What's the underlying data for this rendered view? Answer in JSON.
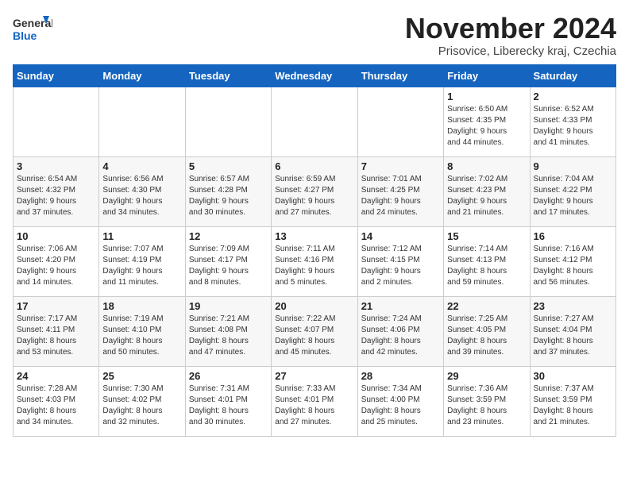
{
  "logo": {
    "text_general": "General",
    "text_blue": "Blue"
  },
  "title": "November 2024",
  "subtitle": "Prisovice, Liberecky kraj, Czechia",
  "days_of_week": [
    "Sunday",
    "Monday",
    "Tuesday",
    "Wednesday",
    "Thursday",
    "Friday",
    "Saturday"
  ],
  "weeks": [
    [
      {
        "day": "",
        "info": ""
      },
      {
        "day": "",
        "info": ""
      },
      {
        "day": "",
        "info": ""
      },
      {
        "day": "",
        "info": ""
      },
      {
        "day": "",
        "info": ""
      },
      {
        "day": "1",
        "info": "Sunrise: 6:50 AM\nSunset: 4:35 PM\nDaylight: 9 hours\nand 44 minutes."
      },
      {
        "day": "2",
        "info": "Sunrise: 6:52 AM\nSunset: 4:33 PM\nDaylight: 9 hours\nand 41 minutes."
      }
    ],
    [
      {
        "day": "3",
        "info": "Sunrise: 6:54 AM\nSunset: 4:32 PM\nDaylight: 9 hours\nand 37 minutes."
      },
      {
        "day": "4",
        "info": "Sunrise: 6:56 AM\nSunset: 4:30 PM\nDaylight: 9 hours\nand 34 minutes."
      },
      {
        "day": "5",
        "info": "Sunrise: 6:57 AM\nSunset: 4:28 PM\nDaylight: 9 hours\nand 30 minutes."
      },
      {
        "day": "6",
        "info": "Sunrise: 6:59 AM\nSunset: 4:27 PM\nDaylight: 9 hours\nand 27 minutes."
      },
      {
        "day": "7",
        "info": "Sunrise: 7:01 AM\nSunset: 4:25 PM\nDaylight: 9 hours\nand 24 minutes."
      },
      {
        "day": "8",
        "info": "Sunrise: 7:02 AM\nSunset: 4:23 PM\nDaylight: 9 hours\nand 21 minutes."
      },
      {
        "day": "9",
        "info": "Sunrise: 7:04 AM\nSunset: 4:22 PM\nDaylight: 9 hours\nand 17 minutes."
      }
    ],
    [
      {
        "day": "10",
        "info": "Sunrise: 7:06 AM\nSunset: 4:20 PM\nDaylight: 9 hours\nand 14 minutes."
      },
      {
        "day": "11",
        "info": "Sunrise: 7:07 AM\nSunset: 4:19 PM\nDaylight: 9 hours\nand 11 minutes."
      },
      {
        "day": "12",
        "info": "Sunrise: 7:09 AM\nSunset: 4:17 PM\nDaylight: 9 hours\nand 8 minutes."
      },
      {
        "day": "13",
        "info": "Sunrise: 7:11 AM\nSunset: 4:16 PM\nDaylight: 9 hours\nand 5 minutes."
      },
      {
        "day": "14",
        "info": "Sunrise: 7:12 AM\nSunset: 4:15 PM\nDaylight: 9 hours\nand 2 minutes."
      },
      {
        "day": "15",
        "info": "Sunrise: 7:14 AM\nSunset: 4:13 PM\nDaylight: 8 hours\nand 59 minutes."
      },
      {
        "day": "16",
        "info": "Sunrise: 7:16 AM\nSunset: 4:12 PM\nDaylight: 8 hours\nand 56 minutes."
      }
    ],
    [
      {
        "day": "17",
        "info": "Sunrise: 7:17 AM\nSunset: 4:11 PM\nDaylight: 8 hours\nand 53 minutes."
      },
      {
        "day": "18",
        "info": "Sunrise: 7:19 AM\nSunset: 4:10 PM\nDaylight: 8 hours\nand 50 minutes."
      },
      {
        "day": "19",
        "info": "Sunrise: 7:21 AM\nSunset: 4:08 PM\nDaylight: 8 hours\nand 47 minutes."
      },
      {
        "day": "20",
        "info": "Sunrise: 7:22 AM\nSunset: 4:07 PM\nDaylight: 8 hours\nand 45 minutes."
      },
      {
        "day": "21",
        "info": "Sunrise: 7:24 AM\nSunset: 4:06 PM\nDaylight: 8 hours\nand 42 minutes."
      },
      {
        "day": "22",
        "info": "Sunrise: 7:25 AM\nSunset: 4:05 PM\nDaylight: 8 hours\nand 39 minutes."
      },
      {
        "day": "23",
        "info": "Sunrise: 7:27 AM\nSunset: 4:04 PM\nDaylight: 8 hours\nand 37 minutes."
      }
    ],
    [
      {
        "day": "24",
        "info": "Sunrise: 7:28 AM\nSunset: 4:03 PM\nDaylight: 8 hours\nand 34 minutes."
      },
      {
        "day": "25",
        "info": "Sunrise: 7:30 AM\nSunset: 4:02 PM\nDaylight: 8 hours\nand 32 minutes."
      },
      {
        "day": "26",
        "info": "Sunrise: 7:31 AM\nSunset: 4:01 PM\nDaylight: 8 hours\nand 30 minutes."
      },
      {
        "day": "27",
        "info": "Sunrise: 7:33 AM\nSunset: 4:01 PM\nDaylight: 8 hours\nand 27 minutes."
      },
      {
        "day": "28",
        "info": "Sunrise: 7:34 AM\nSunset: 4:00 PM\nDaylight: 8 hours\nand 25 minutes."
      },
      {
        "day": "29",
        "info": "Sunrise: 7:36 AM\nSunset: 3:59 PM\nDaylight: 8 hours\nand 23 minutes."
      },
      {
        "day": "30",
        "info": "Sunrise: 7:37 AM\nSunset: 3:59 PM\nDaylight: 8 hours\nand 21 minutes."
      }
    ]
  ]
}
